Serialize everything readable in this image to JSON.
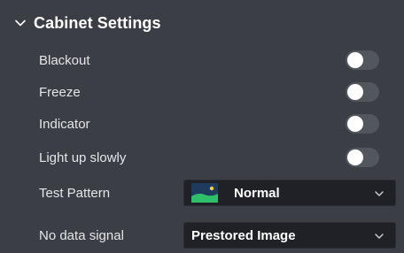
{
  "panel": {
    "title": "Cabinet Settings",
    "expanded": true
  },
  "toggles": [
    {
      "label": "Blackout",
      "on": false
    },
    {
      "label": "Freeze",
      "on": false
    },
    {
      "label": "Indicator",
      "on": false
    },
    {
      "label": "Light up slowly",
      "on": false
    }
  ],
  "test_pattern": {
    "label": "Test Pattern",
    "value": "Normal",
    "icon": "landscape-image-icon"
  },
  "no_data_signal": {
    "label": "No data signal",
    "value": "Prestored Image"
  },
  "colors": {
    "background": "#3b3e44",
    "select_background": "#1f2127",
    "toggle_off": "#52565d",
    "thumb_green": "#2fbf6a",
    "thumb_sky": "#1e3a5c"
  }
}
